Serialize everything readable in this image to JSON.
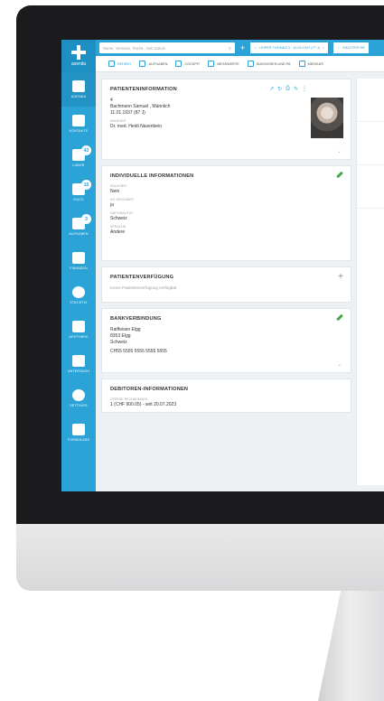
{
  "app": {
    "logo_text": "axenita"
  },
  "sidebar": {
    "items": [
      {
        "label": "AGENDA",
        "icon": "calendar-icon"
      },
      {
        "label": "KONTAKTE",
        "icon": "contacts-icon"
      },
      {
        "label": "LABOR",
        "icon": "lab-flask-icon",
        "badge": "43"
      },
      {
        "label": "DOCS",
        "icon": "document-icon",
        "badge": "15"
      },
      {
        "label": "AUFGABEN",
        "icon": "checklist-icon",
        "badge": "3"
      },
      {
        "label": "FINANZEN",
        "icon": "coins-icon"
      },
      {
        "label": "STATISTIK",
        "icon": "pie-chart-icon"
      },
      {
        "label": "APOTHEKE",
        "icon": "pharmacy-cross-icon"
      },
      {
        "label": "UNTERSUCH",
        "icon": "pulse-icon"
      },
      {
        "label": "SETTINGS",
        "icon": "gear-icon"
      },
      {
        "label": "FORMULARE",
        "icon": "form-pen-icon"
      }
    ]
  },
  "topbar": {
    "search_placeholder": "Name, Vorname, Pat.Nr., Geb.Datum",
    "tabs": [
      {
        "label": "HOPER THOMAS 3 . 10.03.1947 (77 J)"
      },
      {
        "label": "GÄCHTER HE"
      }
    ]
  },
  "subtabs": [
    {
      "label": "PATIENT"
    },
    {
      "label": "AUFGABEN"
    },
    {
      "label": "COCKPIT"
    },
    {
      "label": "MESSWERTE"
    },
    {
      "label": "DIAGNOSEN UND PA"
    },
    {
      "label": "MEDIKATI"
    }
  ],
  "patient_info": {
    "title": "PATIENTENINFORMATION",
    "number": "4",
    "name": "Bachmann Samuel , Männlich",
    "birth": "11.01.1937 (87 J)",
    "mandant_label": "MANDANT",
    "mandant": "Dr. med. Heidi Nasenbein"
  },
  "individual_info": {
    "title": "INDIVIDUELLE INFORMATIONEN",
    "fields": [
      {
        "label": "RAUCHER",
        "value": "Nein"
      },
      {
        "label": "KG GESCANNT",
        "value": "ja"
      },
      {
        "label": "NATIONALITÄT",
        "value": "Schweiz"
      },
      {
        "label": "SPRACHE",
        "value": "Andere"
      }
    ]
  },
  "disposition": {
    "title": "PATIENTENVERFÜGUNG",
    "empty_text": "Keine Patientenverfügung verfügbar"
  },
  "bank": {
    "title": "BANKVERBINDUNG",
    "bank_name": "Raiffeisen Elgg",
    "city": "8353 Elgg",
    "country": "Schweiz",
    "iban": "CH55 5555 5555 5555 5555"
  },
  "debtor": {
    "title": "DEBITOREN-INFORMATIONEN",
    "label": "OFFENE RECHNUNGEN",
    "value": "1 (CHF 900.05) - seit 20.07.2023"
  }
}
